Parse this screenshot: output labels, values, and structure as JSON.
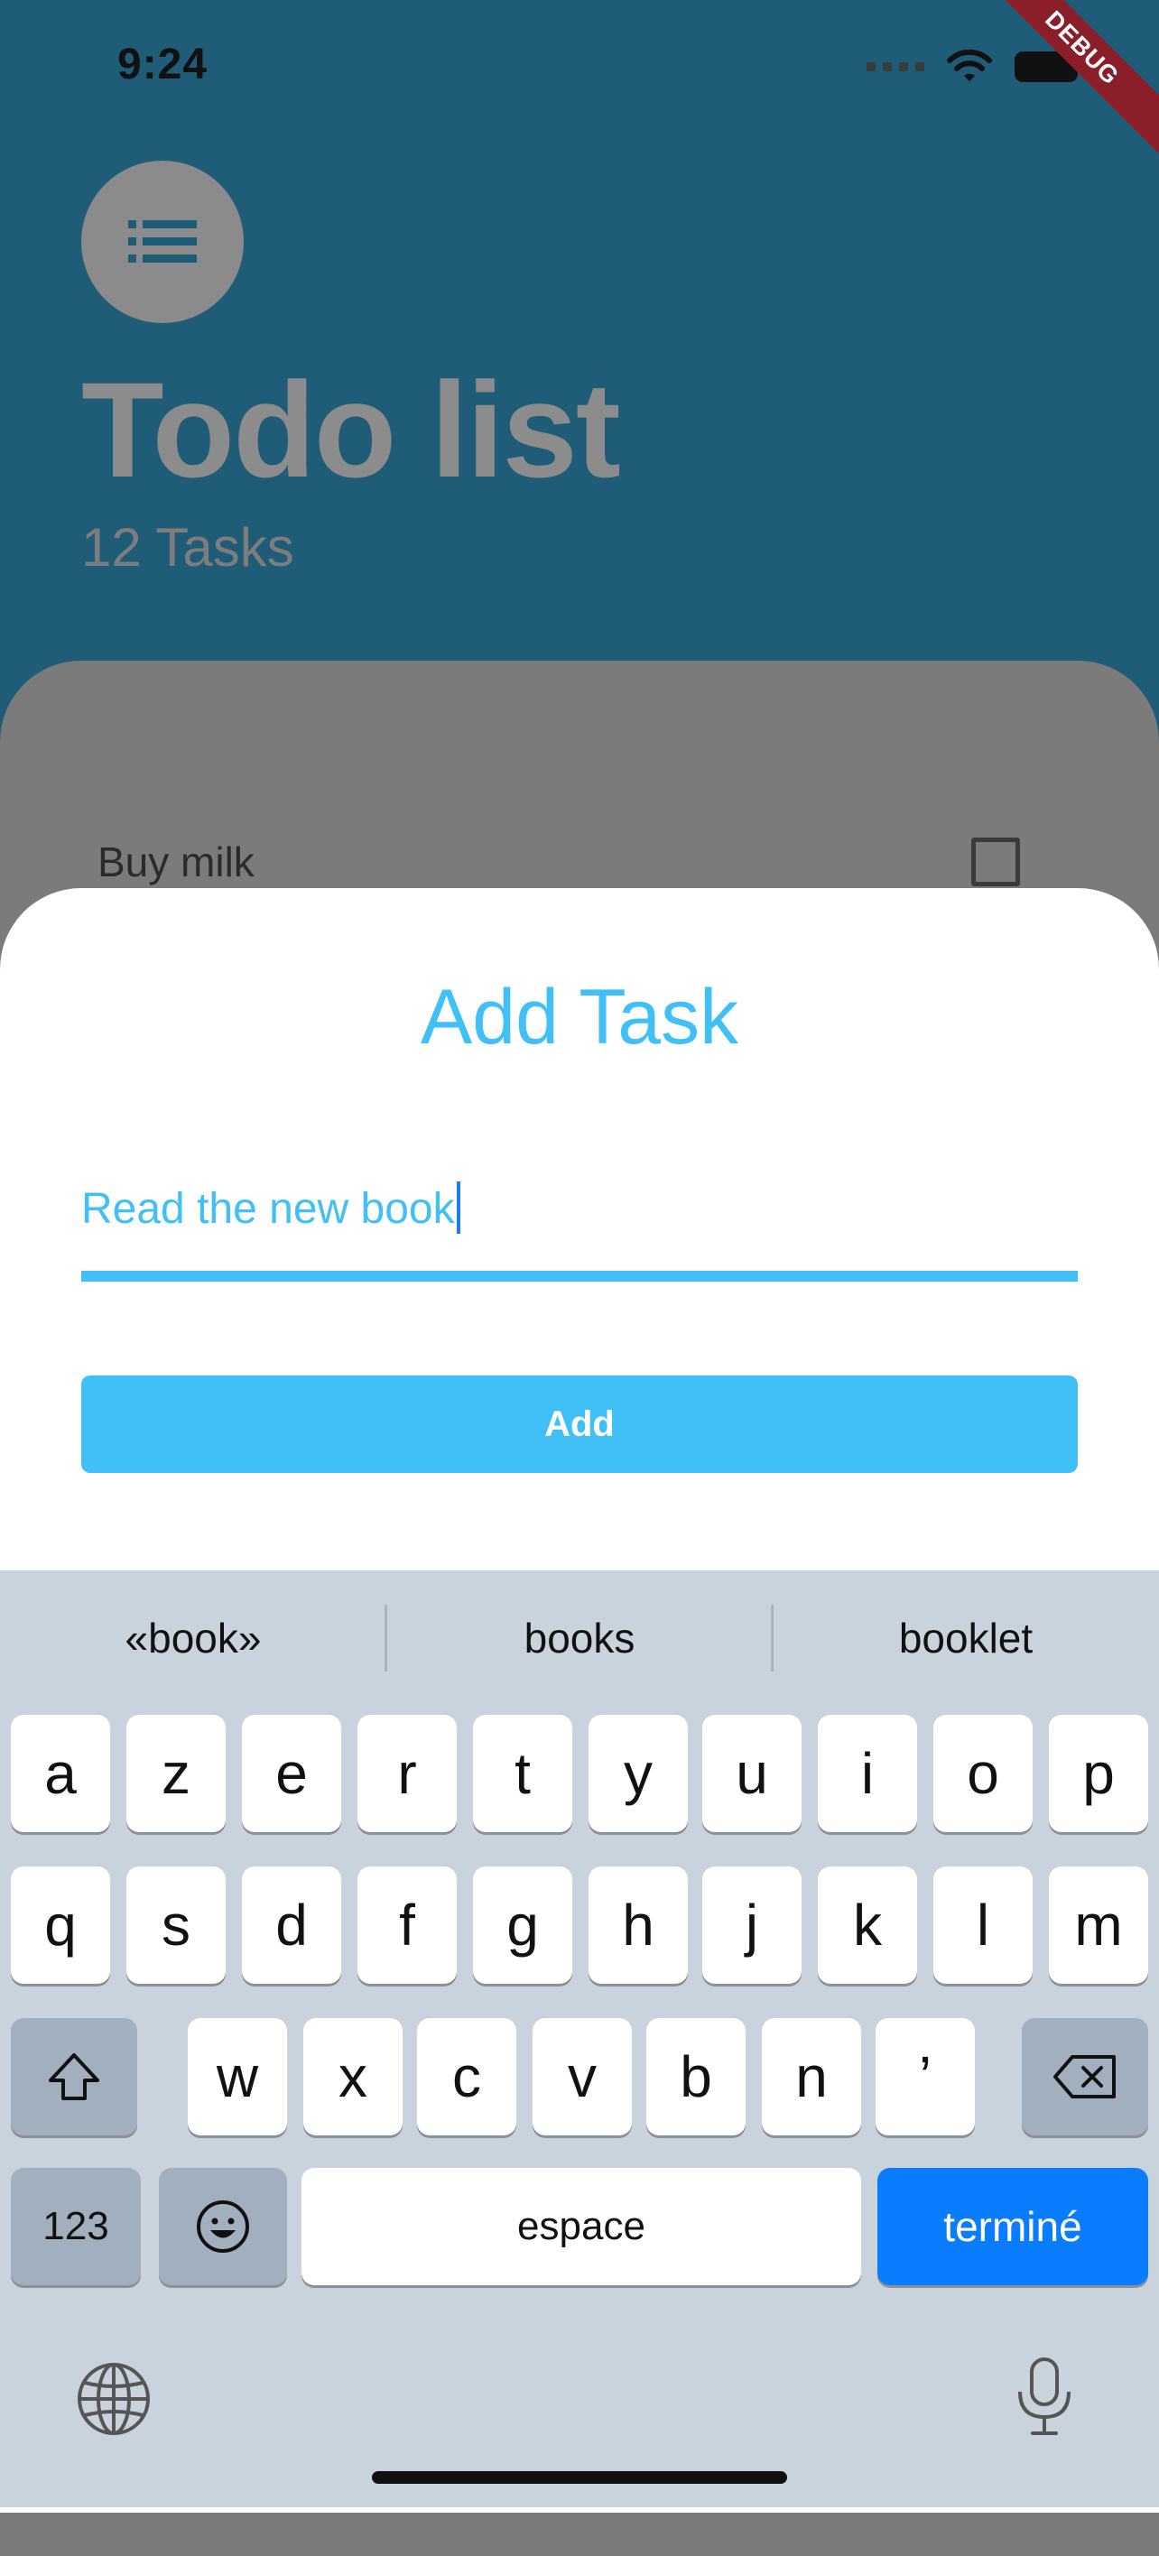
{
  "status_bar": {
    "time": "9:24"
  },
  "debug_banner": "DEBUG",
  "app": {
    "title": "Todo list",
    "tasks_count": "12 Tasks",
    "list_items": [
      {
        "label": "Buy milk",
        "checked": false
      }
    ]
  },
  "sheet": {
    "title": "Add Task",
    "input_value": "Read the new book",
    "add_button": "Add"
  },
  "keyboard": {
    "suggestions": [
      "«book»",
      "books",
      "booklet"
    ],
    "row1": [
      "a",
      "z",
      "e",
      "r",
      "t",
      "y",
      "u",
      "i",
      "o",
      "p"
    ],
    "row2": [
      "q",
      "s",
      "d",
      "f",
      "g",
      "h",
      "j",
      "k",
      "l",
      "m"
    ],
    "row3": [
      "w",
      "x",
      "c",
      "v",
      "b",
      "n",
      "’"
    ],
    "numbers_key": "123",
    "space_key": "espace",
    "done_key": "terminé"
  },
  "colors": {
    "accent": "#41c0f7",
    "background": "#1f5c77",
    "done_key": "#0a7dfe"
  }
}
